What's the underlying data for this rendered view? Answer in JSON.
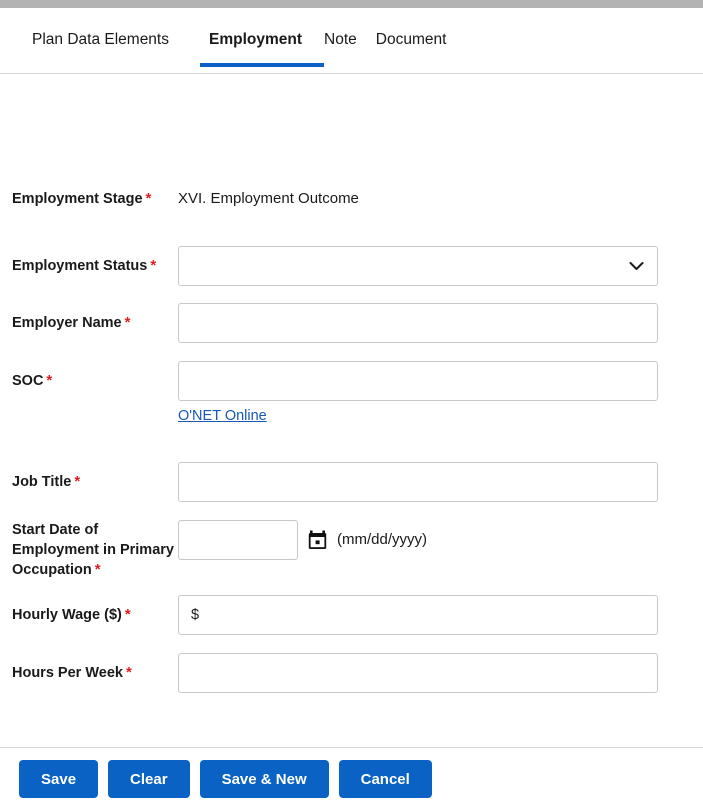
{
  "window": {
    "top_bar_color": "#b3b3b3"
  },
  "tabs": {
    "items": [
      {
        "label": "Plan Data Elements",
        "active": false
      },
      {
        "label": "Employment",
        "active": true
      },
      {
        "label": "Note",
        "active": false
      },
      {
        "label": "Document",
        "active": false
      }
    ],
    "active_underline_color": "#0b5fc7"
  },
  "form": {
    "required_marker": "*",
    "fields": {
      "employment_stage": {
        "label": "Employment Stage",
        "value": "XVI. Employment Outcome"
      },
      "employment_status": {
        "label": "Employment Status",
        "value": "",
        "placeholder": "",
        "options": [
          ""
        ],
        "icon": "chevron-down-icon"
      },
      "employer_name": {
        "label": "Employer Name",
        "value": "",
        "placeholder": ""
      },
      "soc": {
        "label": "SOC",
        "value": "",
        "placeholder": "",
        "link_label": "O'NET Online"
      },
      "job_title": {
        "label": "Job Title",
        "value": "",
        "placeholder": ""
      },
      "start_date": {
        "label": "Start Date of Employment in Primary Occupation",
        "value": "",
        "placeholder": "",
        "format_hint": "(mm/dd/yyyy)",
        "icon": "calendar-icon"
      },
      "hourly_wage": {
        "label": "Hourly Wage ($)",
        "value": "$",
        "placeholder": ""
      },
      "hours_per_week": {
        "label": "Hours Per Week",
        "value": "",
        "placeholder": ""
      }
    }
  },
  "footer": {
    "buttons": [
      {
        "label": "Save",
        "name": "save-button"
      },
      {
        "label": "Clear",
        "name": "clear-button"
      },
      {
        "label": "Save & New",
        "name": "save-and-new-button"
      },
      {
        "label": "Cancel",
        "name": "cancel-button"
      }
    ],
    "button_color": "#0a62c4"
  }
}
